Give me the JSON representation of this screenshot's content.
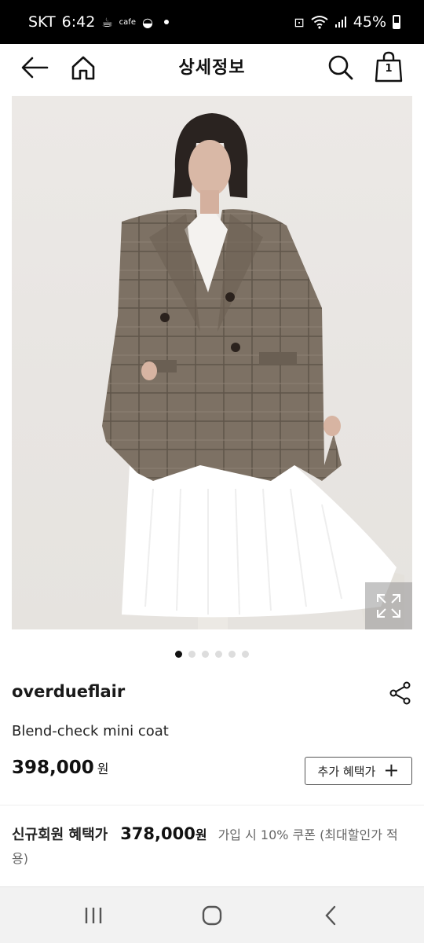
{
  "status_bar": {
    "carrier": "SKT",
    "time": "6:42",
    "cafe_label": "cafe",
    "battery": "45%"
  },
  "header": {
    "title": "상세정보",
    "cart_count": "1"
  },
  "gallery": {
    "page_count": 6,
    "active_index": 0
  },
  "product": {
    "brand": "overdueflair",
    "name": "Blend-check mini coat",
    "price": "398,000",
    "currency": "원",
    "extra_benefit_label": "추가 혜택가"
  },
  "member_benefit": {
    "label": "신규회원 혜택가",
    "price": "378,000",
    "currency": "원",
    "note": "가입 시 10% 쿠폰 (최대할인가 적용)"
  },
  "icons": {
    "back": "arrow-left-icon",
    "home": "home-icon",
    "search": "search-icon",
    "cart": "shopping-bag-icon",
    "share": "share-icon",
    "zoom": "expand-icon"
  }
}
